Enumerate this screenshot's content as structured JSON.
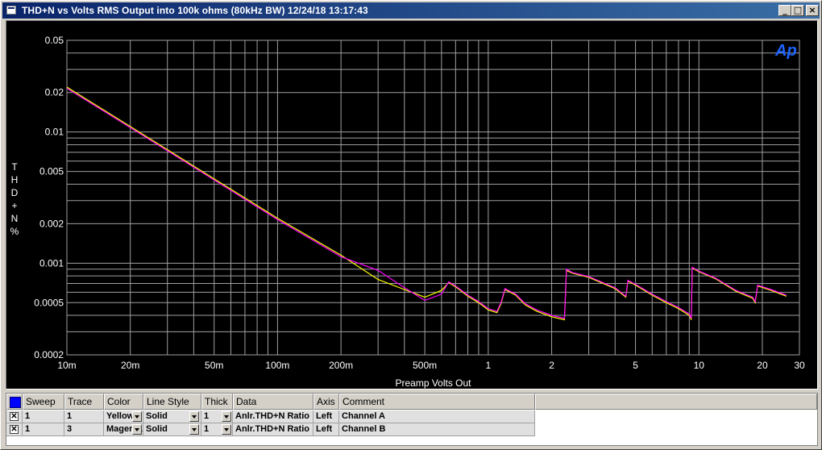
{
  "window": {
    "title": "THD+N vs Volts RMS Output into 100k ohms (80kHz BW)  12/24/18 13:17:43",
    "minimize_label": "_",
    "maximize_label": "□",
    "close_label": "×"
  },
  "chart_data": {
    "type": "line",
    "title": "",
    "xlabel": "Preamp Volts Out",
    "ylabel": "THD+N %",
    "xscale": "log",
    "yscale": "log",
    "xlim": [
      0.01,
      30
    ],
    "ylim": [
      0.0002,
      0.05
    ],
    "x_ticks": [
      0.01,
      0.02,
      0.05,
      0.1,
      0.2,
      0.5,
      1,
      2,
      5,
      10,
      20,
      30
    ],
    "x_tick_labels": [
      "10m",
      "20m",
      "50m",
      "100m",
      "200m",
      "500m",
      "1",
      "2",
      "5",
      "10",
      "20",
      "30"
    ],
    "y_ticks": [
      0.05,
      0.02,
      0.01,
      0.005,
      0.002,
      0.001,
      0.0005,
      0.0002
    ],
    "y_tick_labels": [
      "0.05",
      "0.02",
      "0.01",
      "0.005",
      "0.002",
      "0.001",
      "0.0005",
      "0.0002"
    ],
    "grid": true,
    "logo": "Ap",
    "background": "#000000",
    "grid_color": "#a0a0a0",
    "series": [
      {
        "name": "Channel A",
        "color": "#ffff00",
        "x": [
          0.01,
          0.02,
          0.05,
          0.1,
          0.2,
          0.3,
          0.4,
          0.5,
          0.6,
          0.65,
          0.7,
          0.8,
          0.9,
          1.0,
          1.1,
          1.15,
          1.2,
          1.35,
          1.5,
          1.7,
          2.0,
          2.3,
          2.35,
          2.5,
          3,
          4,
          4.5,
          4.6,
          5,
          6,
          7,
          8,
          9,
          9.2,
          9.3,
          10,
          12,
          15,
          18,
          18.5,
          19,
          22,
          26
        ],
        "y": [
          0.022,
          0.011,
          0.0044,
          0.0022,
          0.00115,
          0.00075,
          0.00063,
          0.00055,
          0.00062,
          0.00071,
          0.00066,
          0.00056,
          0.0005,
          0.00044,
          0.00042,
          0.00049,
          0.00063,
          0.00057,
          0.00048,
          0.00043,
          0.00039,
          0.00037,
          0.00088,
          0.00084,
          0.00078,
          0.00064,
          0.00055,
          0.00073,
          0.00068,
          0.00057,
          0.0005,
          0.00045,
          0.0004,
          0.00037,
          0.00092,
          0.00086,
          0.00076,
          0.00061,
          0.00054,
          0.0005,
          0.00067,
          0.00062,
          0.00056
        ]
      },
      {
        "name": "Channel B",
        "color": "#ff00ff",
        "x": [
          0.01,
          0.02,
          0.05,
          0.1,
          0.2,
          0.3,
          0.4,
          0.5,
          0.6,
          0.65,
          0.7,
          0.8,
          0.9,
          1.0,
          1.1,
          1.15,
          1.2,
          1.35,
          1.5,
          1.7,
          2.0,
          2.3,
          2.35,
          2.5,
          3,
          4,
          4.5,
          4.6,
          5,
          6,
          7,
          8,
          9,
          9.2,
          9.3,
          10,
          12,
          15,
          18,
          18.5,
          19,
          22,
          26
        ],
        "y": [
          0.0215,
          0.0108,
          0.0043,
          0.00215,
          0.00112,
          0.00088,
          0.00065,
          0.00052,
          0.00058,
          0.00072,
          0.00067,
          0.00057,
          0.00051,
          0.00045,
          0.00043,
          0.0005,
          0.00064,
          0.00058,
          0.00049,
          0.00044,
          0.0004,
          0.00038,
          0.0009,
          0.00085,
          0.00079,
          0.00065,
          0.00056,
          0.00074,
          0.00069,
          0.00058,
          0.00051,
          0.00046,
          0.00041,
          0.00038,
          0.00093,
          0.00087,
          0.00077,
          0.00062,
          0.00055,
          0.00051,
          0.00068,
          0.00063,
          0.00057
        ]
      }
    ]
  },
  "table": {
    "headers": [
      "Sweep",
      "Trace",
      "Color",
      "Line Style",
      "Thick",
      "Data",
      "Axis",
      "Comment"
    ],
    "rows": [
      {
        "checked": "✕",
        "sweep": "1",
        "trace": "1",
        "color": "Yellow",
        "line_style": "Solid",
        "thick": "1",
        "data": "Anlr.THD+N Ratio",
        "axis": "Left",
        "comment": "Channel A"
      },
      {
        "checked": "✕",
        "sweep": "1",
        "trace": "3",
        "color": "Magenta",
        "line_style": "Solid",
        "thick": "1",
        "data": "Anlr.THD+N Ratio",
        "axis": "Left",
        "comment": "Channel B"
      }
    ]
  }
}
